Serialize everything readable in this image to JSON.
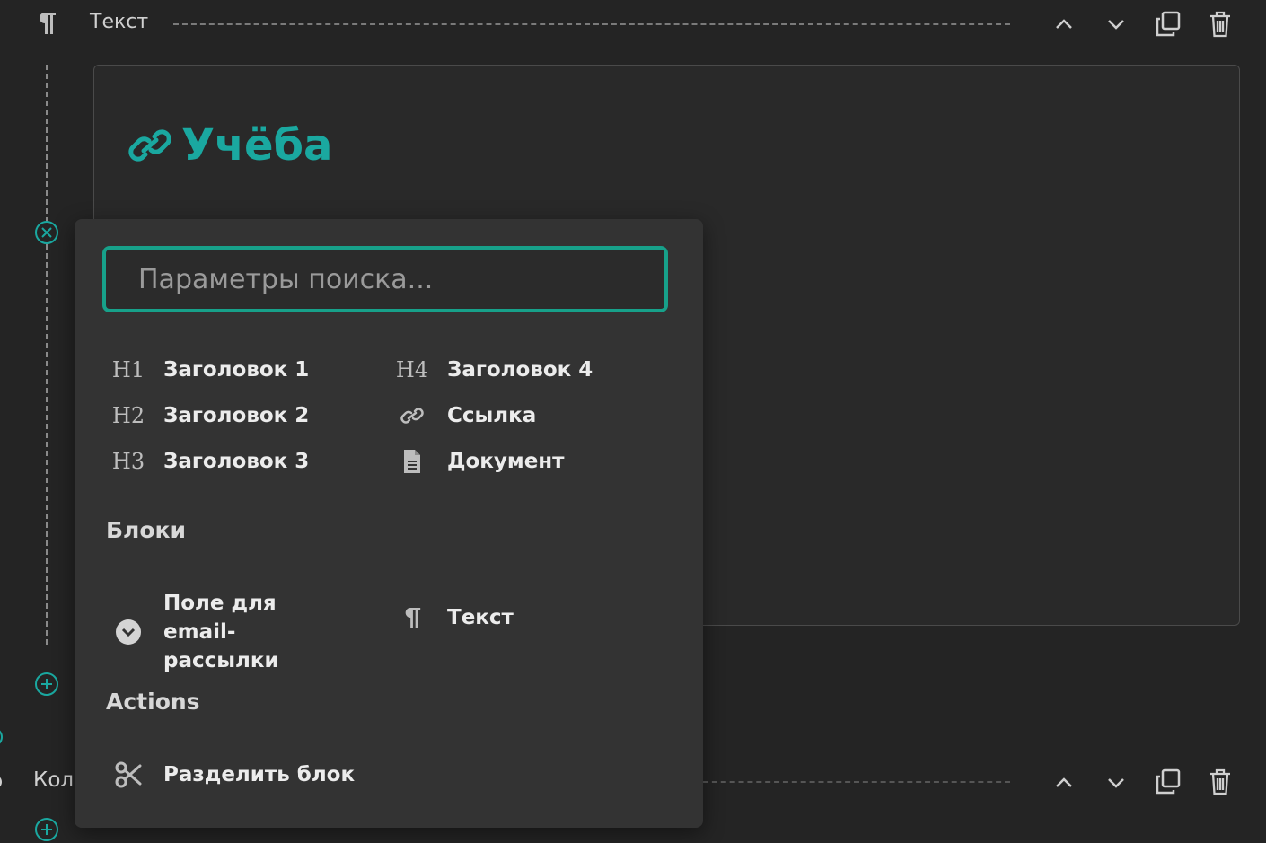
{
  "top_block": {
    "title": "Текст",
    "icons": [
      "paragraph-icon",
      "chevron-up-icon",
      "chevron-down-icon",
      "duplicate-icon",
      "trash-icon"
    ]
  },
  "content": {
    "heading": "Учёба",
    "heading_icon": "link-icon"
  },
  "popup": {
    "search": {
      "placeholder": "Параметры поиска...",
      "value": ""
    },
    "items": [
      {
        "icon": "H1",
        "label": "Заголовок 1"
      },
      {
        "icon": "H2",
        "label": "Заголовок 2"
      },
      {
        "icon": "H3",
        "label": "Заголовок 3"
      },
      {
        "icon": "H4",
        "label": "Заголовок 4"
      },
      {
        "icon": "link-icon",
        "label": "Ссылка"
      },
      {
        "icon": "document-icon",
        "label": "Документ"
      }
    ],
    "sections": {
      "blocks": {
        "title": "Блоки",
        "items": [
          {
            "icon": "chevron-circle-icon",
            "label": "Поле для email-рассылки"
          },
          {
            "icon": "paragraph-icon",
            "label": "Текст"
          }
        ]
      },
      "actions": {
        "title": "Actions",
        "items": [
          {
            "icon": "scissors-icon",
            "label": "Разделить блок"
          }
        ]
      }
    }
  },
  "bottom_block": {
    "title": "Кол"
  },
  "colors": {
    "accent": "#1aa8a0",
    "search_border": "#17a18a",
    "background": "#242424",
    "popup": "#333333"
  }
}
